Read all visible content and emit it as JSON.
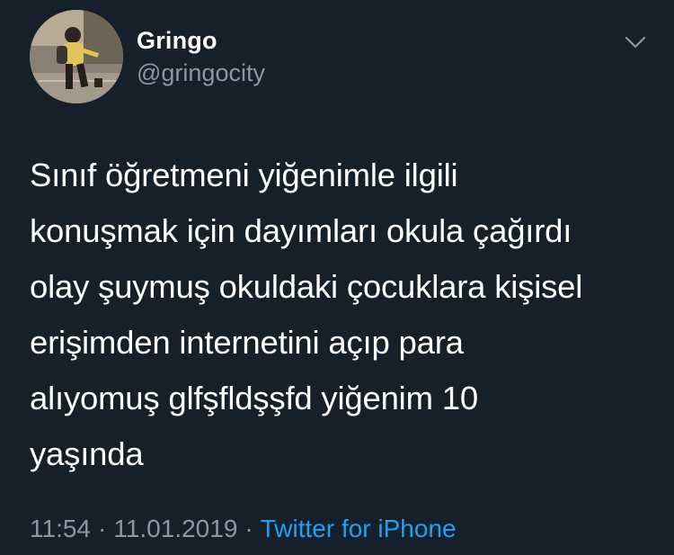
{
  "user": {
    "display_name": "Gringo",
    "handle": "@gringocity"
  },
  "tweet": {
    "text_lines": [
      "Sınıf öğretmeni yiğenimle ilgili",
      "konuşmak için dayımları okula çağırdı",
      "olay şuymuş okuldaki çocuklara kişisel",
      "erişimden internetini açıp para",
      "alıyomuş glfşfldşşfd yiğenim 10",
      "yaşında"
    ],
    "time": "11:54",
    "date": "11.01.2019",
    "separator": "·",
    "source": "Twitter for iPhone"
  },
  "icons": {
    "menu": "chevron-down-icon",
    "avatar": "avatar"
  },
  "colors": {
    "background": "#15202b",
    "primary_text": "#ffffff",
    "secondary_text": "#8899a6",
    "link": "#1da1f2"
  }
}
